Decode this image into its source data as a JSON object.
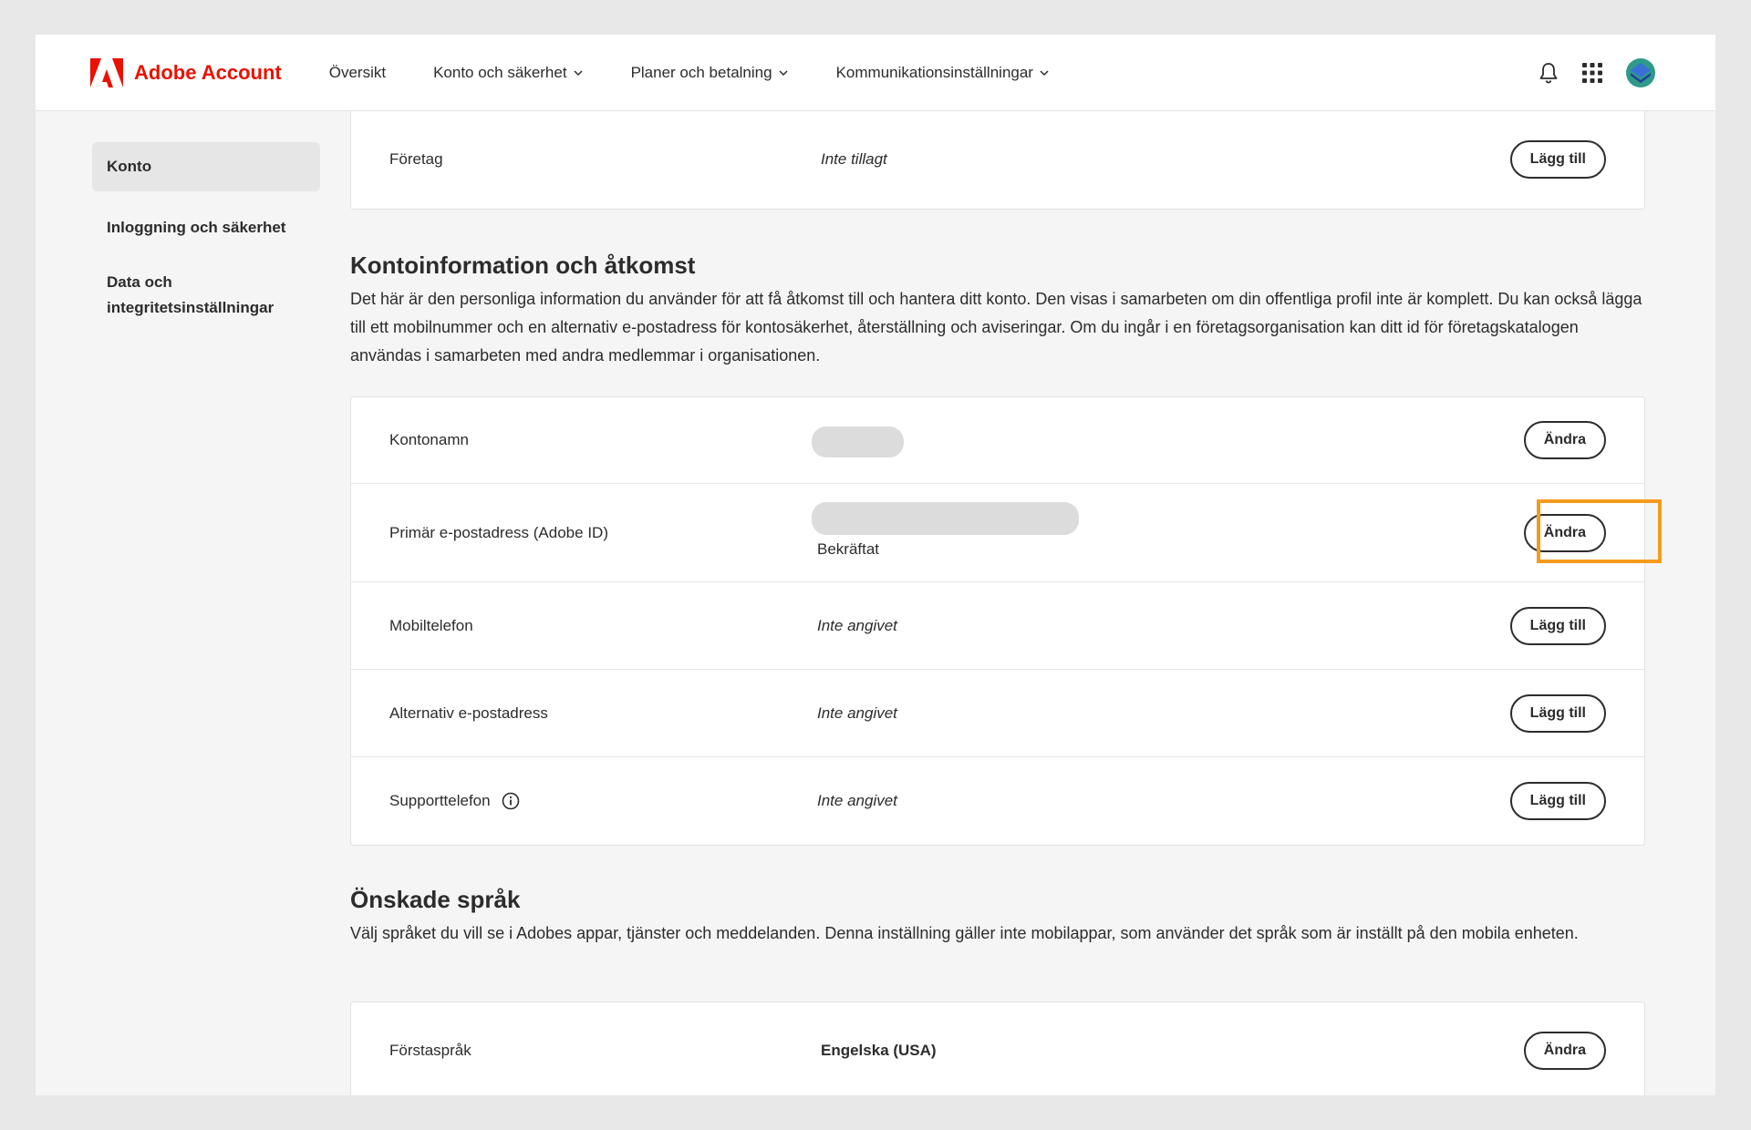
{
  "header": {
    "brand": "Adobe Account",
    "nav": [
      {
        "label": "Översikt",
        "dropdown": false
      },
      {
        "label": "Konto och säkerhet",
        "dropdown": true
      },
      {
        "label": "Planer och betalning",
        "dropdown": true
      },
      {
        "label": "Kommunikationsinställningar",
        "dropdown": true
      }
    ],
    "icons": [
      "bell-icon",
      "apps-grid-icon",
      "profile-avatar"
    ]
  },
  "sidebar": {
    "items": [
      {
        "label": "Konto",
        "active": true
      },
      {
        "label": "Inloggning och säkerhet",
        "active": false
      },
      {
        "label": "Data och integritetsinställningar",
        "active": false
      }
    ]
  },
  "company": {
    "label": "Företag",
    "value": "Inte tillagt",
    "button": "Lägg till"
  },
  "account_info": {
    "title": "Kontoinformation och åtkomst",
    "description": "Det här är den personliga information du använder för att få åtkomst till och hantera ditt konto. Den visas i samarbeten om din offentliga profil inte är komplett. Du kan också lägga till ett mobilnummer och en alternativ e-postadress för kontosäkerhet, återställning och aviseringar. Om du ingår i en företagsorganisation kan ditt id för företagskatalogen användas i samarbeten med andra medlemmar i organisationen.",
    "rows": [
      {
        "label": "Kontonamn",
        "value": "",
        "button": "Ändra"
      },
      {
        "label": "Primär e-postadress (Adobe ID)",
        "value": "",
        "status": "Bekräftat",
        "button": "Ändra"
      },
      {
        "label": "Mobiltelefon",
        "value": "Inte angivet",
        "button": "Lägg till"
      },
      {
        "label": "Alternativ e-postadress",
        "value": "Inte angivet",
        "button": "Lägg till"
      },
      {
        "label": "Supporttelefon",
        "value": "Inte angivet",
        "button": "Lägg till"
      }
    ]
  },
  "languages": {
    "title": "Önskade språk",
    "description": "Välj språket du vill se i Adobes appar, tjänster och meddelanden. Denna inställning gäller inte mobilappar, som använder det språk som är inställt på den mobila enheten.",
    "rows": [
      {
        "label": "Förstaspråk",
        "value": "Engelska (USA)",
        "button": "Ändra"
      }
    ]
  },
  "colors": {
    "brand_red": "#eb1000",
    "highlight_orange": "#f59b1c"
  }
}
